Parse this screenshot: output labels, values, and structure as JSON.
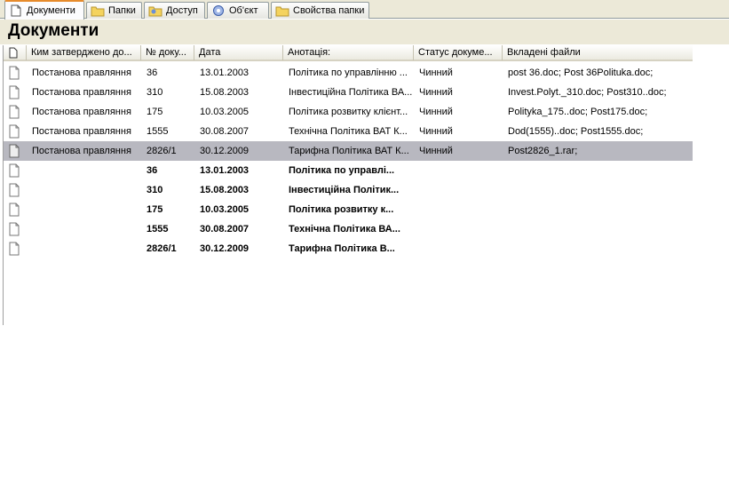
{
  "tabs": [
    {
      "label": "Документи",
      "icon": "document-icon",
      "active": true
    },
    {
      "label": "Папки",
      "icon": "folder-icon",
      "active": false
    },
    {
      "label": "Доступ",
      "icon": "access-icon",
      "active": false
    },
    {
      "label": "Об'єкт",
      "icon": "object-gear-icon",
      "active": false
    },
    {
      "label": "Свойства папки",
      "icon": "folder-properties-icon",
      "active": false
    }
  ],
  "page_title": "Документи",
  "columns": {
    "icon": "",
    "approved_by": "Ким затверджено до...",
    "doc_number": "№ доку...",
    "date": "Дата",
    "annotation": "Анотація:",
    "status": "Статус докуме...",
    "attachments": "Вкладені файли"
  },
  "rows": [
    {
      "approved_by": "Постанова правляння",
      "doc_number": "36",
      "date": "13.01.2003",
      "annotation": "Політика  по управлінню ...",
      "status": "Чинний",
      "attachments": "post 36.doc; Post 36Polituka.doc;"
    },
    {
      "approved_by": "Постанова правляння",
      "doc_number": "310",
      "date": "15.08.2003",
      "annotation": "Інвестиційна Політика ВА...",
      "status": "Чинний",
      "attachments": "Invest.Polyt._310.doc; Post310..doc;"
    },
    {
      "approved_by": "Постанова правляння",
      "doc_number": "175",
      "date": "10.03.2005",
      "annotation": "Політика розвитку клієнт...",
      "status": "Чинний",
      "attachments": "Polityka_175..doc; Post175.doc;"
    },
    {
      "approved_by": "Постанова правляння",
      "doc_number": "1555",
      "date": "30.08.2007",
      "annotation": "Технічна Політика ВАТ К...",
      "status": "Чинний",
      "attachments": "Dod(1555)..doc; Post1555.doc;"
    },
    {
      "approved_by": "Постанова правляння",
      "doc_number": "2826/1",
      "date": "30.12.2009",
      "annotation": "Тарифна Політика ВАТ К...",
      "status": "Чинний",
      "attachments": "Post2826_1.rar;"
    }
  ],
  "bold_rows": [
    {
      "doc_number": "36",
      "date": "13.01.2003",
      "annotation": "Політика  по управлі..."
    },
    {
      "doc_number": "310",
      "date": "15.08.2003",
      "annotation": "Інвестиційна Політик..."
    },
    {
      "doc_number": "175",
      "date": "10.03.2005",
      "annotation": "Політика розвитку к..."
    },
    {
      "doc_number": "1555",
      "date": "30.08.2007",
      "annotation": "Технічна Політика ВА..."
    },
    {
      "doc_number": "2826/1",
      "date": "30.12.2009",
      "annotation": "Тарифна Політика В..."
    }
  ],
  "selected_row": 4,
  "colors": {
    "selection": "#b8b8c0",
    "tab_highlight": "#e68b2c",
    "panel": "#ece9d8"
  }
}
